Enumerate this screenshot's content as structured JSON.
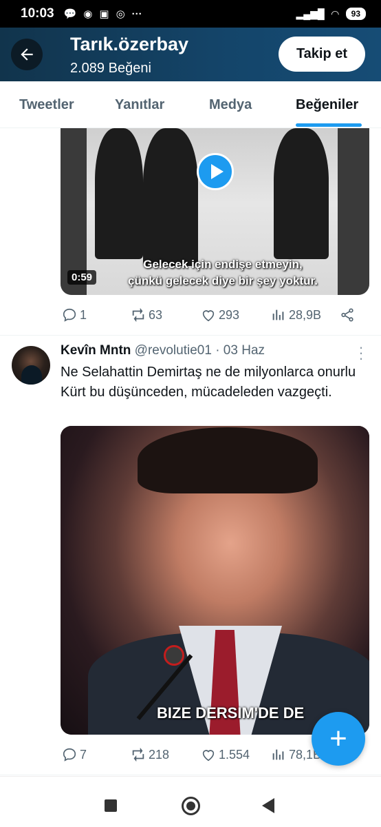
{
  "status_bar": {
    "time": "10:03",
    "battery": "93"
  },
  "header": {
    "title": "Tarık.özerbay",
    "subtitle": "2.089 Beğeni",
    "follow_label": "Takip et"
  },
  "tabs": [
    {
      "label": "Tweetler"
    },
    {
      "label": "Yanıtlar"
    },
    {
      "label": "Medya"
    },
    {
      "label": "Beğeniler",
      "active": true
    }
  ],
  "tweet1": {
    "video_duration": "0:59",
    "subtitle_line1": "Gelecek için endişe etmeyin,",
    "subtitle_line2": "çünkü gelecek diye bir şey yoktur.",
    "replies": "1",
    "retweets": "63",
    "likes": "293",
    "views": "28,9B"
  },
  "tweet2": {
    "author_name": "Kevîn Mntn",
    "handle": "@revolutie01",
    "date": "· 03 Haz",
    "text": "Ne Selahattin Demirtaş ne de milyonlarca onurlu Kürt bu düşünceden, mücadeleden vazgeçti.",
    "video_subtitle": "BIZE DERSIM'DE DE",
    "replies": "7",
    "retweets": "218",
    "likes": "1.554",
    "views": "78,1B"
  },
  "colors": {
    "accent": "#1d9bf0",
    "header_bg": "#14456a",
    "text_primary": "#0f1419",
    "text_secondary": "#536471"
  }
}
